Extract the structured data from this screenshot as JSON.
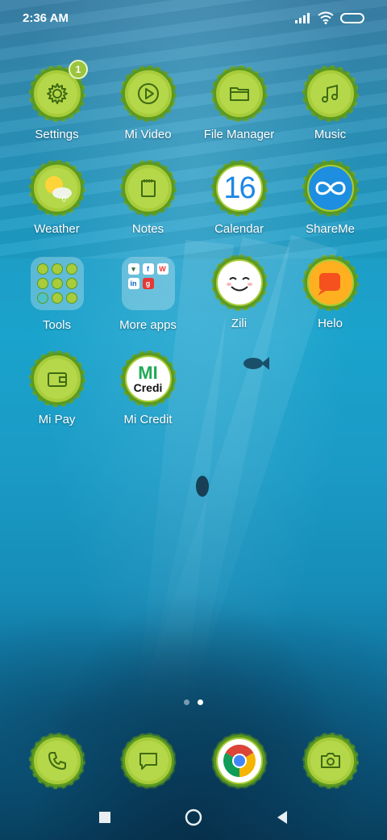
{
  "status_bar": {
    "time": "2:36 AM"
  },
  "apps": [
    {
      "label": "Settings",
      "badge": "1"
    },
    {
      "label": "Mi Video"
    },
    {
      "label": "File Manager"
    },
    {
      "label": "Music"
    },
    {
      "label": "Weather",
      "temp": "0°"
    },
    {
      "label": "Notes"
    },
    {
      "label": "Calendar",
      "day": "16"
    },
    {
      "label": "ShareMe"
    },
    {
      "label": "Tools"
    },
    {
      "label": "More apps"
    },
    {
      "label": "Zili"
    },
    {
      "label": "Helo"
    },
    {
      "label": "Mi Pay"
    },
    {
      "label": "Mi Credit",
      "logo_top": "MI",
      "logo_bottom": "Credi"
    }
  ],
  "page_indicator": {
    "pages": 2,
    "active": 2
  },
  "dock": [
    "phone-icon",
    "messages-icon",
    "chrome-icon",
    "camera-icon"
  ],
  "colors": {
    "icon_fill": "#a8cc3a",
    "icon_border": "#5c9a1e"
  }
}
